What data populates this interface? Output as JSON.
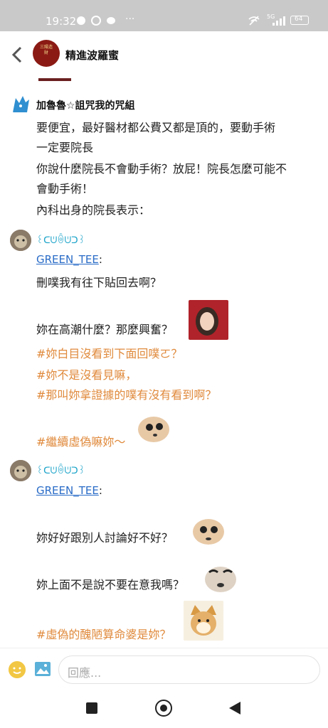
{
  "status": {
    "time": "19:32",
    "dots": "···",
    "network": "5G",
    "battery": "64"
  },
  "header": {
    "title": "精進波羅蜜",
    "avatar_text": "三陽造財"
  },
  "posts": [
    {
      "user": "加魯魯☆詛咒我的咒組",
      "lines": [
        "要便宜，最好醫材都公費又都是頂的，要動手術",
        "一定要院長",
        "你說什麼院長不會動手術？放屁！院長怎麼可能不",
        "會動手術！",
        "內科出身的院長表示："
      ]
    },
    {
      "user": "꒰ᑕᕫꉺᕫᑐ꒱",
      "mention": "GREEN_TEE",
      "lines": [
        "刪噗我有往下貼回去啊？",
        "妳在高潮什麼？那麼興奮？",
        "#妳白目沒看到下面回噗ㄛ？",
        "#妳不是沒看見嘛，",
        "#那叫妳拿證據的噗有沒有看到啊？",
        "#繼續虛偽嘛妳～"
      ]
    },
    {
      "user": "꒰ᑕᕫꉺᕫᑐ꒱",
      "mention": "GREEN_TEE",
      "lines": [
        "妳好好跟別人討論好不好？",
        "妳上面不是說不要在意我嗎？",
        "#虛偽的醜陋算命婆是妳？"
      ]
    }
  ],
  "composer": {
    "placeholder": "回應..."
  }
}
